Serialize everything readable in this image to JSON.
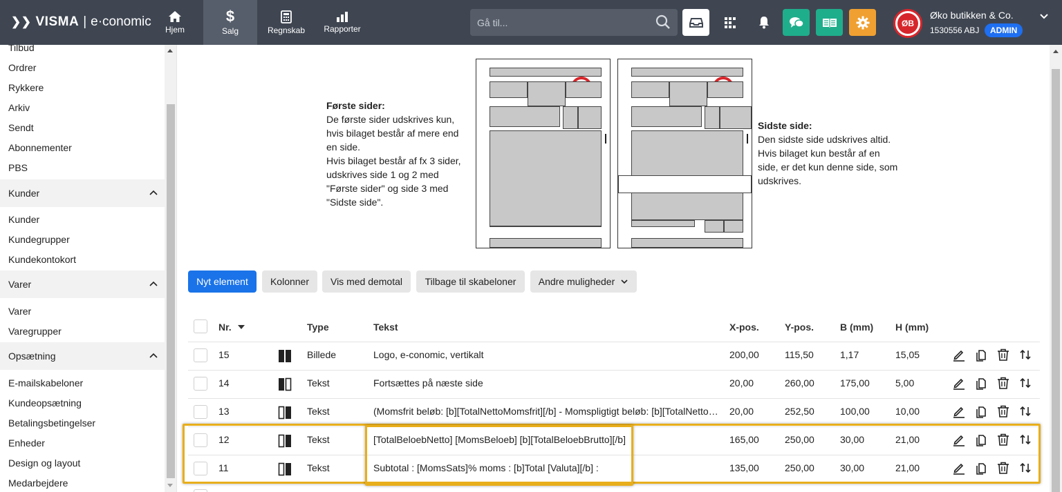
{
  "topbar": {
    "brand": "VISMA",
    "brand_sep": "|",
    "product": "e·conomic",
    "nav": [
      {
        "label": "Hjem",
        "icon": "home-icon"
      },
      {
        "label": "Salg",
        "icon": "dollar-icon"
      },
      {
        "label": "Regnskab",
        "icon": "calculator-icon"
      },
      {
        "label": "Rapporter",
        "icon": "bar-chart-icon"
      }
    ],
    "search_placeholder": "Gå til...",
    "company_name": "Øko butikken & Co.",
    "company_number": "1530556 ABJ",
    "role_badge": "ADMIN",
    "colors": {
      "bar": "#3f4652",
      "green": "#1fae8c",
      "orange": "#f0a030",
      "admin": "#1e6ff1"
    }
  },
  "sidebar": {
    "top_items": [
      "Tilbud",
      "Ordrer",
      "Rykkere",
      "Arkiv",
      "Sendt",
      "Abonnementer",
      "PBS"
    ],
    "sections": [
      {
        "title": "Kunder",
        "items": [
          "Kunder",
          "Kundegrupper",
          "Kundekontokort"
        ]
      },
      {
        "title": "Varer",
        "items": [
          "Varer",
          "Varegrupper"
        ]
      },
      {
        "title": "Opsætning",
        "items": [
          "E-mailskabeloner",
          "Kundeopsætning",
          "Betalingsbetingelser",
          "Enheder",
          "Design og layout",
          "Medarbejdere"
        ]
      }
    ]
  },
  "preview": {
    "first_title": "Første sider:",
    "first_lines": [
      "De første sider udskrives kun,",
      "hvis bilaget består af mere end",
      "en side.",
      "Hvis bilaget består af fx 3 sider,",
      "udskrives side 1 og 2 med",
      "\"Første sider\" og side 3 med",
      "\"Sidste side\"."
    ],
    "last_title": "Sidste side:",
    "last_lines": [
      "Den sidste side udskrives altid.",
      "Hvis bilaget kun består af en",
      "side, er det kun denne side, som",
      "udskrives."
    ]
  },
  "toolbar": {
    "new_element": "Nyt element",
    "columns": "Kolonner",
    "show_demo": "Vis med demotal",
    "back": "Tilbage til skabeloner",
    "more": "Andre muligheder"
  },
  "table": {
    "headers": {
      "nr": "Nr.",
      "type": "Type",
      "text": "Tekst",
      "x": "X-pos.",
      "y": "Y-pos.",
      "b": "B (mm)",
      "h": "H (mm)"
    },
    "rows": [
      {
        "nr": "15",
        "type": "Billede",
        "icon": "both-pages-icon",
        "text": "Logo, e-conomic, vertikalt",
        "x": "200,00",
        "y": "115,50",
        "b": "1,17",
        "h": "15,05"
      },
      {
        "nr": "14",
        "type": "Tekst",
        "icon": "first-page-icon",
        "text": "Fortsættes på næste side",
        "x": "20,00",
        "y": "260,00",
        "b": "175,00",
        "h": "5,00"
      },
      {
        "nr": "13",
        "type": "Tekst",
        "icon": "last-page-icon",
        "text": "(Momsfrit beløb: [b][TotalNettoMomsfrit][/b] - Momspligtigt beløb: [b][TotalNettoMomspligtigt][/b])",
        "x": "20,00",
        "y": "252,50",
        "b": "100,00",
        "h": "10,00"
      },
      {
        "nr": "12",
        "type": "Tekst",
        "icon": "last-page-icon",
        "text": "[TotalBeloebNetto] [MomsBeloeb] [b][TotalBeloebBrutto][/b]",
        "x": "165,00",
        "y": "250,00",
        "b": "30,00",
        "h": "21,00"
      },
      {
        "nr": "11",
        "type": "Tekst",
        "icon": "last-page-icon",
        "text": "Subtotal : [MomsSats]% moms : [b]Total [Valuta][/b] :",
        "x": "135,00",
        "y": "250,00",
        "b": "30,00",
        "h": "21,00"
      }
    ]
  }
}
